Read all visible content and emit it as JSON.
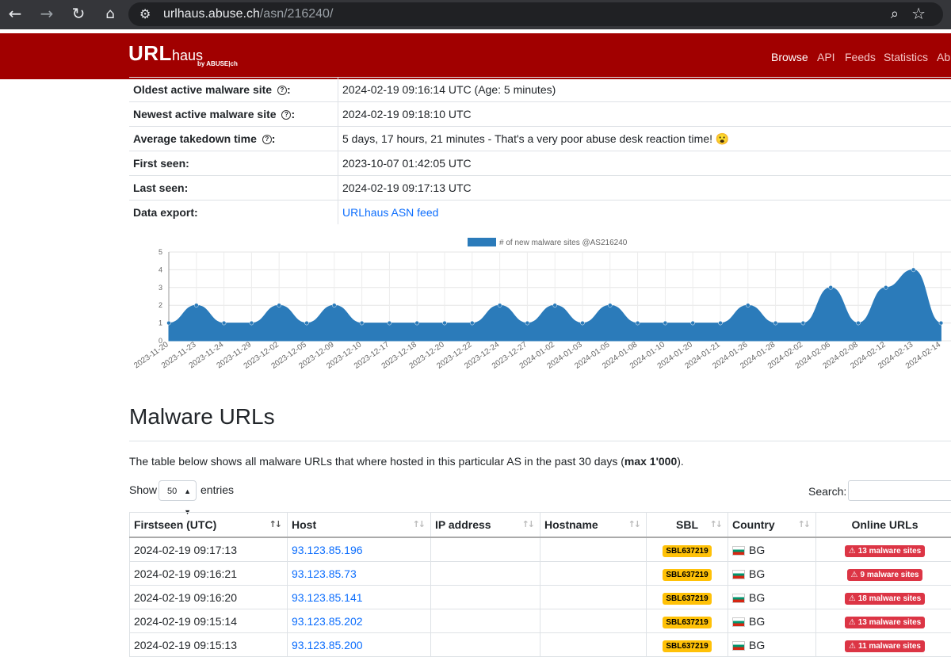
{
  "browser": {
    "url_host": "urlhaus.abuse.ch",
    "url_path": "/asn/216240/"
  },
  "navbar": {
    "brand_url": "URL",
    "brand_haus": "haus",
    "brand_sub": "by ABUSE|ch",
    "links": [
      "Browse",
      "API",
      "Feeds",
      "Statistics",
      "Ab"
    ]
  },
  "info": {
    "rows": [
      {
        "key": "Oldest active malware site",
        "value": "2024-02-19 09:16:14 UTC (Age: 5 minutes)"
      },
      {
        "key": "Newest active malware site",
        "value": "2024-02-19 09:18:10 UTC"
      },
      {
        "key": "Average takedown time",
        "value": "5 days, 17 hours, 21 minutes - That's a very poor abuse desk reaction time! 😮"
      },
      {
        "key": "First seen:",
        "value": "2023-10-07 01:42:05 UTC"
      },
      {
        "key": "Last seen:",
        "value": "2024-02-19 09:17:13 UTC"
      },
      {
        "key": "Data export:",
        "value": "URLhaus ASN feed"
      }
    ],
    "colon": ":"
  },
  "chart_data": {
    "type": "area",
    "title": "",
    "series": [
      {
        "name": "# of new malware sites @AS216240",
        "values": [
          1,
          2,
          1,
          1,
          2,
          1,
          2,
          1,
          1,
          1,
          1,
          1,
          2,
          1,
          2,
          1,
          2,
          1,
          1,
          1,
          1,
          2,
          1,
          1,
          3,
          1,
          3,
          4,
          1
        ]
      }
    ],
    "categories": [
      "2023-11-20",
      "2023-11-23",
      "2023-11-24",
      "2023-11-29",
      "2023-12-02",
      "2023-12-05",
      "2023-12-09",
      "2023-12-10",
      "2023-12-17",
      "2023-12-18",
      "2023-12-20",
      "2023-12-22",
      "2023-12-24",
      "2023-12-27",
      "2024-01-02",
      "2024-01-03",
      "2024-01-05",
      "2024-01-08",
      "2024-01-10",
      "2024-01-20",
      "2024-01-21",
      "2024-01-26",
      "2024-01-28",
      "2024-02-02",
      "2024-02-06",
      "2024-02-08",
      "2024-02-12",
      "2024-02-13",
      "2024-02-14"
    ],
    "yticks": [
      "0",
      "1",
      "2",
      "3",
      "4",
      "5"
    ],
    "ylim": [
      0,
      5
    ],
    "color": "#2b7bba",
    "grid": true,
    "legend_position": "top"
  },
  "malware": {
    "heading": "Malware URLs",
    "desc_prefix": "The table below shows all malware URLs that where hosted in this particular AS in the past 30 days (",
    "desc_bold": "max 1'000",
    "desc_suffix": ").",
    "show": "Show",
    "entries_value": "50",
    "entries": "entries",
    "search": "Search:",
    "columns": [
      "Firstseen (UTC)",
      "Host",
      "IP address",
      "Hostname",
      "SBL",
      "Country",
      "Online URLs"
    ],
    "rows": [
      {
        "firstseen": "2024-02-19 09:17:13",
        "host": "93.123.85.196",
        "ip": "",
        "hostname": "",
        "sbl": "SBL637219",
        "country": "BG",
        "online": "13 malware sites"
      },
      {
        "firstseen": "2024-02-19 09:16:21",
        "host": "93.123.85.73",
        "ip": "",
        "hostname": "",
        "sbl": "SBL637219",
        "country": "BG",
        "online": "9 malware sites"
      },
      {
        "firstseen": "2024-02-19 09:16:20",
        "host": "93.123.85.141",
        "ip": "",
        "hostname": "",
        "sbl": "SBL637219",
        "country": "BG",
        "online": "18 malware sites"
      },
      {
        "firstseen": "2024-02-19 09:15:14",
        "host": "93.123.85.202",
        "ip": "",
        "hostname": "",
        "sbl": "SBL637219",
        "country": "BG",
        "online": "13 malware sites"
      },
      {
        "firstseen": "2024-02-19 09:15:13",
        "host": "93.123.85.200",
        "ip": "",
        "hostname": "",
        "sbl": "SBL637219",
        "country": "BG",
        "online": "11 malware sites"
      }
    ]
  }
}
